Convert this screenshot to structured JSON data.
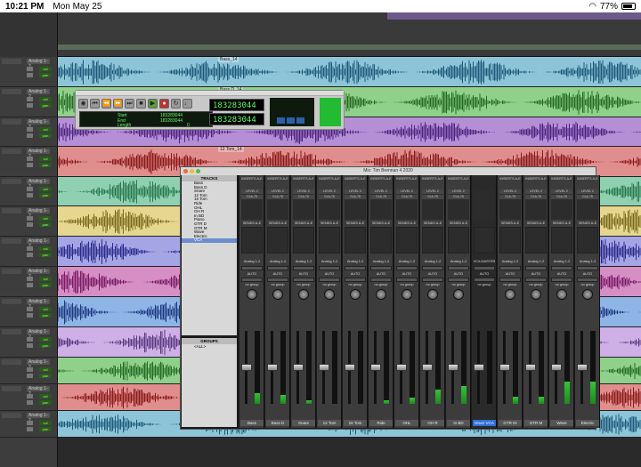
{
  "status_bar": {
    "time": "10:21 PM",
    "date": "Mon May 25",
    "battery": "77%"
  },
  "transport": {
    "counter_main": "183283044",
    "counter_secondary": "183283044",
    "labels": {
      "start": "Start",
      "end": "End",
      "length": "Length"
    },
    "start_value": "183283044",
    "end_value": "183283044",
    "length_value": "0"
  },
  "mix_window": {
    "title": "Mix: Tim Brennan 4 2020",
    "tracks_header": "TRACKS",
    "track_items": [
      "Bass",
      "Bass D",
      "Snare",
      "12 Tom",
      "16 Tom",
      "Ride",
      "OHL",
      "OH R",
      "In BD",
      "Piano",
      "GTR D",
      "GTR M",
      "Wave",
      "Electric",
      "VCA"
    ],
    "highlighted_track": "Drum VCA",
    "groups_header": "GROUPS",
    "group_items": [
      "<ALL>"
    ]
  },
  "strips": [
    {
      "name": "Bass",
      "inserts": [
        "LEVEL 2",
        "CLA-76"
      ],
      "io": "Analog 1-2",
      "auto": "AUTO",
      "group": "no group",
      "meter": 0.15
    },
    {
      "name": "Bass D",
      "inserts": [
        "LEVEL 2",
        "CLA-76"
      ],
      "io": "Analog 1-2",
      "auto": "AUTO",
      "group": "no group",
      "meter": 0.12
    },
    {
      "name": "Snare",
      "inserts": [
        "LEVEL 2",
        "CLA-76"
      ],
      "io": "Analog 1-2",
      "auto": "AUTO",
      "group": "no group",
      "meter": 0.05
    },
    {
      "name": "12 Tom",
      "inserts": [
        "LEVEL 2",
        "CLA-76"
      ],
      "io": "Analog 1-2",
      "auto": "AUTO",
      "group": "no group",
      "meter": 0.0
    },
    {
      "name": "16 Tom",
      "inserts": [
        "LEVEL 2",
        "CLA-76"
      ],
      "io": "Analog 1-2",
      "auto": "AUTO",
      "group": "no group",
      "meter": 0.0
    },
    {
      "name": "Ride",
      "inserts": [
        "LEVEL 2",
        "CLA-76"
      ],
      "io": "Analog 1-2",
      "auto": "AUTO",
      "group": "no group",
      "meter": 0.05
    },
    {
      "name": "OHL",
      "inserts": [
        "LEVEL 2",
        "CLA-76"
      ],
      "io": "Analog 1-2",
      "auto": "AUTO",
      "group": "no group",
      "meter": 0.08
    },
    {
      "name": "OH R",
      "inserts": [
        "LEVEL 2",
        "CLA-76"
      ],
      "io": "Analog 1-2",
      "auto": "AUTO",
      "group": "no group",
      "meter": 0.2
    },
    {
      "name": "In BD",
      "inserts": [
        "LEVEL 2",
        "CLA-76"
      ],
      "io": "Analog 1-2",
      "auto": "AUTO",
      "group": "no group",
      "meter": 0.25
    },
    {
      "name": "Drum VCA",
      "inserts": [],
      "io": "VCA MASTER",
      "auto": "AUTO",
      "group": "no group",
      "meter": 0.0,
      "vca": true
    },
    {
      "name": "GTR DI",
      "inserts": [
        "LEVEL 2",
        "CLA-76"
      ],
      "io": "Analog 1-2",
      "auto": "AUTO",
      "group": "no group",
      "meter": 0.1
    },
    {
      "name": "GTR M",
      "inserts": [
        "LEVEL 2",
        "CLA-76"
      ],
      "io": "Analog 1-2",
      "auto": "AUTO",
      "group": "no group",
      "meter": 0.1
    },
    {
      "name": "Wave",
      "inserts": [
        "LEVEL 2",
        "CLA-76"
      ],
      "io": "Analog 1-2",
      "auto": "AUTO",
      "group": "no group",
      "meter": 0.3
    },
    {
      "name": "Electric",
      "inserts": [
        "LEVEL 2",
        "CLA-76"
      ],
      "io": "Analog 1-2",
      "auto": "AUTO",
      "group": "no group",
      "meter": 0.3
    }
  ],
  "lanes": [
    {
      "color": "#8ec4d8",
      "wave": "#1f5a7a",
      "clip": "Bass_14"
    },
    {
      "color": "#8fd08a",
      "wave": "#246b24",
      "clip": "Bass D_14"
    },
    {
      "color": "#b58fd6",
      "wave": "#4d2480",
      "clip": ""
    },
    {
      "color": "#e08d8d",
      "wave": "#8a1c1c",
      "clip": "12 Tom_14"
    },
    {
      "color": "#8fd0b0",
      "wave": "#2a7a52",
      "clip": ""
    },
    {
      "color": "#e6d68f",
      "wave": "#7a6a1c",
      "clip": ""
    },
    {
      "color": "#a5a5e6",
      "wave": "#2a2a8a",
      "clip": ""
    },
    {
      "color": "#d68fc4",
      "wave": "#7a1c66",
      "clip": ""
    },
    {
      "color": "#8fb4e6",
      "wave": "#1c3a80",
      "clip": ""
    },
    {
      "color": "#cfb0e6",
      "wave": "#5a3a80",
      "clip": ""
    },
    {
      "color": "#8fd08a",
      "wave": "#246b24",
      "clip": ""
    },
    {
      "color": "#e08d8d",
      "wave": "#8a1c1c",
      "clip": ""
    },
    {
      "color": "#8ec4d8",
      "wave": "#1f5a7a",
      "clip": ""
    }
  ],
  "left_tracks": {
    "io_label": "Analog 1-2",
    "vol_label": "vol",
    "pan_label": "pan",
    "group_label": "no group"
  }
}
